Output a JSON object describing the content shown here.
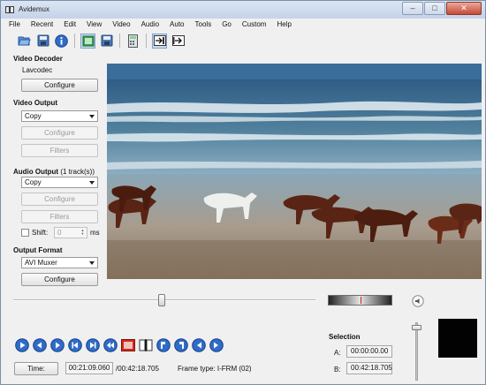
{
  "window": {
    "title": "Avidemux",
    "minimize": "–",
    "maximize": "□",
    "close": "✕",
    "icon": "avidemux-app-icon"
  },
  "menu": {
    "items": [
      "File",
      "Recent",
      "Edit",
      "View",
      "Video",
      "Audio",
      "Auto",
      "Tools",
      "Go",
      "Custom",
      "Help"
    ]
  },
  "toolbar": {
    "icons": [
      "open-icon",
      "save-icon",
      "info-icon",
      "save-video-icon",
      "save-as-icon",
      "calculator-icon",
      "play-filtered-icon",
      "output-preview-icon"
    ]
  },
  "video_decoder": {
    "heading": "Video Decoder",
    "codec": "Lavcodec",
    "configure_label": "Configure"
  },
  "video_output": {
    "heading": "Video Output",
    "selected": "Copy",
    "configure_label": "Configure",
    "filters_label": "Filters"
  },
  "audio_output": {
    "heading": "Audio Output",
    "tracks_note": "(1 track(s))",
    "selected": "Copy",
    "configure_label": "Configure",
    "filters_label": "Filters",
    "shift_label": "Shift:",
    "shift_value": "0",
    "shift_unit": "ms"
  },
  "output_format": {
    "heading": "Output Format",
    "selected": "AVI Muxer",
    "configure_label": "Configure"
  },
  "playback": {
    "position_fraction": 0.49,
    "jog_icon": "jog-shuttle",
    "speaker_icon": "volume-icon",
    "volume_fraction": 0.95,
    "nav_icons": [
      "play-icon",
      "previous-frame-icon",
      "next-frame-icon",
      "previous-keyframe-icon",
      "next-keyframe-icon",
      "previous-black-frame-icon",
      "record-icon",
      "split-icon",
      "set-marker-a-icon",
      "set-marker-b-icon",
      "goto-marker-a-icon",
      "goto-marker-b-icon"
    ]
  },
  "selection": {
    "heading": "Selection",
    "a_label": "A:",
    "a_value": "00:00:00.00",
    "b_label": "B:",
    "b_value": "00:42:18.705"
  },
  "status": {
    "time_button": "Time:",
    "current_time": "00:21:09.060",
    "total_time": "/00:42:18.705",
    "frame_type": "Frame type:  I-FRM (02)"
  },
  "colors": {
    "window_bg": "#f0f0f0",
    "histogram_bg": "#020202",
    "nav_blue": "#2f6cc9"
  }
}
